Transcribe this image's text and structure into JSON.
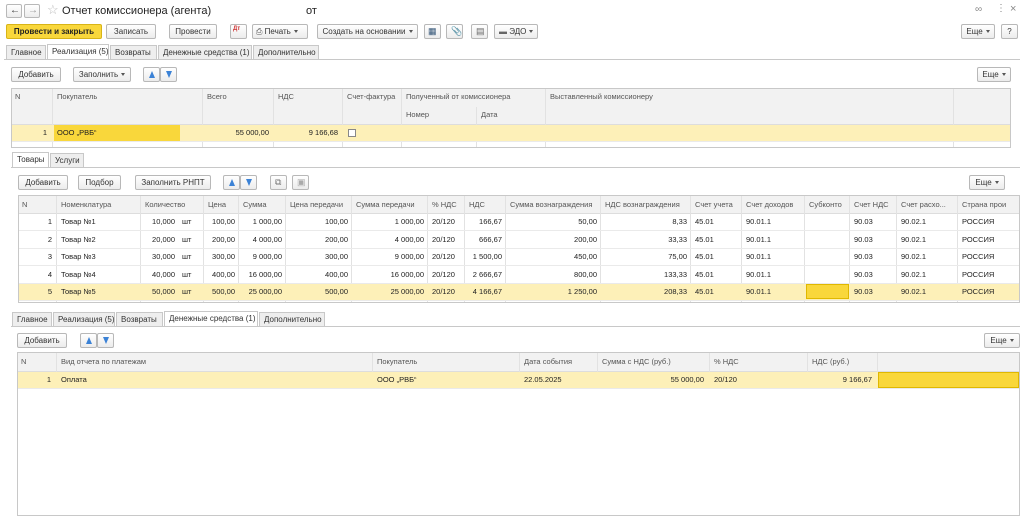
{
  "window": {
    "title": "Отчет комиссионера (агента)",
    "title_suffix": "от"
  },
  "toolbar": {
    "post_close": "Провести и закрыть",
    "save": "Записать",
    "post": "Провести",
    "print": "Печать",
    "create_based": "Создать на основании",
    "edo": "ЭДО",
    "more": "Еще",
    "help": "?"
  },
  "top_tabs": [
    {
      "label": "Главное"
    },
    {
      "label": "Реализация (5)"
    },
    {
      "label": "Возвраты"
    },
    {
      "label": "Денежные средства (1)"
    },
    {
      "label": "Дополнительно"
    }
  ],
  "buyers": {
    "add": "Добавить",
    "fill": "Заполнить",
    "more": "Еще",
    "headers": {
      "n": "N",
      "buyer": "Покупатель",
      "total": "Всего",
      "vat": "НДС",
      "invoice": "Счет-фактура",
      "received": "Полученный от комиссионера",
      "number": "Номер",
      "date": "Дата",
      "issued": "Выставленный комиссионеру"
    },
    "row": {
      "n": "1",
      "buyer": "ООО „РВБ“",
      "total": "55 000,00",
      "vat": "9 166,68"
    }
  },
  "inner_tabs": [
    {
      "label": "Товары"
    },
    {
      "label": "Услуги"
    }
  ],
  "goods": {
    "add": "Добавить",
    "select": "Подбор",
    "fill_rnpt": "Заполнить РНПТ",
    "more": "Еще",
    "headers": {
      "n": "N",
      "item": "Номенклатура",
      "qty": "Количество",
      "price": "Цена",
      "sum": "Сумма",
      "tprice": "Цена передачи",
      "tsum": "Сумма передачи",
      "vatp": "% НДС",
      "vat": "НДС",
      "reward": "Сумма вознаграждения",
      "rewardvat": "НДС вознаграждения",
      "acc": "Счет учета",
      "income": "Счет доходов",
      "subconto": "Субконто",
      "accvat": "Счет НДС",
      "expense": "Счет расхо...",
      "country": "Страна прои"
    },
    "rows": [
      {
        "n": "1",
        "item": "Товар №1",
        "qty": "10,000",
        "unit": "шт",
        "price": "100,00",
        "sum": "1 000,00",
        "tprice": "100,00",
        "tsum": "1 000,00",
        "vatp": "20/120",
        "vat": "166,67",
        "reward": "50,00",
        "rewardvat": "8,33",
        "acc": "45.01",
        "income": "90.01.1",
        "subconto": "",
        "accvat": "90.03",
        "expense": "90.02.1",
        "country": "РОССИЯ"
      },
      {
        "n": "2",
        "item": "Товар №2",
        "qty": "20,000",
        "unit": "шт",
        "price": "200,00",
        "sum": "4 000,00",
        "tprice": "200,00",
        "tsum": "4 000,00",
        "vatp": "20/120",
        "vat": "666,67",
        "reward": "200,00",
        "rewardvat": "33,33",
        "acc": "45.01",
        "income": "90.01.1",
        "subconto": "",
        "accvat": "90.03",
        "expense": "90.02.1",
        "country": "РОССИЯ"
      },
      {
        "n": "3",
        "item": "Товар №3",
        "qty": "30,000",
        "unit": "шт",
        "price": "300,00",
        "sum": "9 000,00",
        "tprice": "300,00",
        "tsum": "9 000,00",
        "vatp": "20/120",
        "vat": "1 500,00",
        "reward": "450,00",
        "rewardvat": "75,00",
        "acc": "45.01",
        "income": "90.01.1",
        "subconto": "",
        "accvat": "90.03",
        "expense": "90.02.1",
        "country": "РОССИЯ"
      },
      {
        "n": "4",
        "item": "Товар №4",
        "qty": "40,000",
        "unit": "шт",
        "price": "400,00",
        "sum": "16 000,00",
        "tprice": "400,00",
        "tsum": "16 000,00",
        "vatp": "20/120",
        "vat": "2 666,67",
        "reward": "800,00",
        "rewardvat": "133,33",
        "acc": "45.01",
        "income": "90.01.1",
        "subconto": "",
        "accvat": "90.03",
        "expense": "90.02.1",
        "country": "РОССИЯ"
      },
      {
        "n": "5",
        "item": "Товар №5",
        "qty": "50,000",
        "unit": "шт",
        "price": "500,00",
        "sum": "25 000,00",
        "tprice": "500,00",
        "tsum": "25 000,00",
        "vatp": "20/120",
        "vat": "4 166,67",
        "reward": "1 250,00",
        "rewardvat": "208,33",
        "acc": "45.01",
        "income": "90.01.1",
        "subconto": "",
        "accvat": "90.03",
        "expense": "90.02.1",
        "country": "РОССИЯ"
      }
    ]
  },
  "bottom_tabs": [
    {
      "label": "Главное"
    },
    {
      "label": "Реализация (5)"
    },
    {
      "label": "Возвраты"
    },
    {
      "label": "Денежные средства (1)"
    },
    {
      "label": "Дополнительно"
    }
  ],
  "payments": {
    "add": "Добавить",
    "more": "Еще",
    "headers": {
      "n": "N",
      "kind": "Вид отчета по платежам",
      "buyer": "Покупатель",
      "date": "Дата события",
      "sum": "Сумма с НДС (руб.)",
      "vatp": "% НДС",
      "vat": "НДС (руб.)"
    },
    "row": {
      "n": "1",
      "kind": "Оплата",
      "buyer": "ООО „РВБ“",
      "date": "22.05.2025",
      "sum": "55 000,00",
      "vatp": "20/120",
      "vat": "9 166,67"
    }
  }
}
